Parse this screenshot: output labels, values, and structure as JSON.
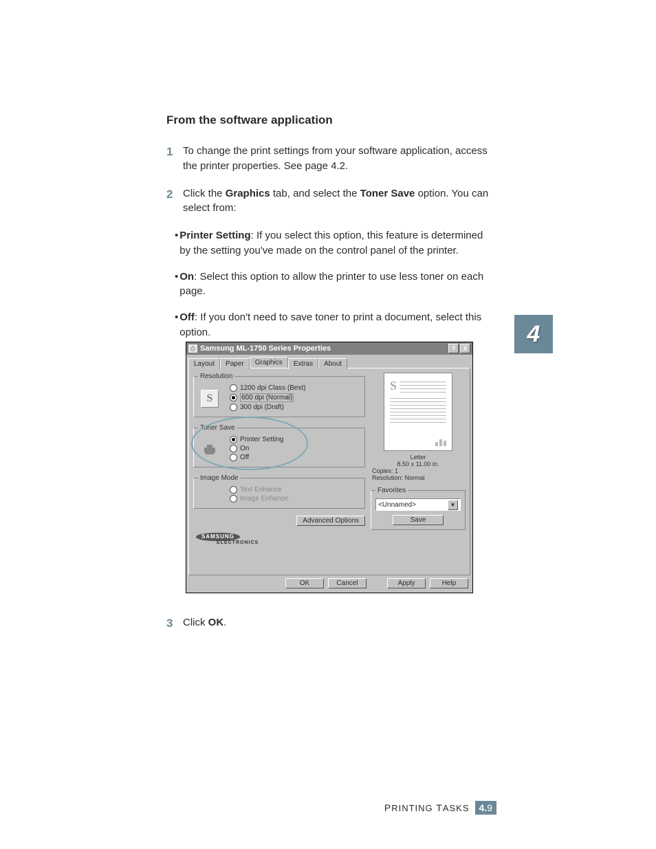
{
  "heading": "From the software application",
  "steps": {
    "s1": {
      "num": "1",
      "text_a": "To change the print settings from your software application, access the printer properties. See page 4.2."
    },
    "s2": {
      "num": "2",
      "text_a": "Click the ",
      "bold_a": "Graphics",
      "text_b": " tab, and select the ",
      "bold_b": "Toner Save",
      "text_c": " option. You can select from:"
    },
    "s3": {
      "num": "3",
      "text_a": "Click ",
      "bold_a": "OK",
      "text_b": "."
    }
  },
  "bullets": {
    "b1": {
      "bold": "Printer Setting",
      "text": ": If you select this option, this feature is determined by the setting you've made on the control panel of the printer."
    },
    "b2": {
      "bold": "On",
      "text": ": Select this option to allow the printer to use less toner on each page."
    },
    "b3": {
      "bold": "Off",
      "text": ": If you don't need to save toner to print a document, select this option."
    }
  },
  "chapter": "4",
  "footer": {
    "title": "PRINTING TASKS",
    "chapter": "4.",
    "page": "9"
  },
  "dialog": {
    "title": "Samsung ML-1750 Series Properties",
    "help": "?",
    "close": "X",
    "tabs": {
      "layout": "Layout",
      "paper": "Paper",
      "graphics": "Graphics",
      "extras": "Extras",
      "about": "About"
    },
    "resolution": {
      "legend": "Resolution",
      "r1": "1200 dpi Class (Best)",
      "r2": "600 dpi (Normal)",
      "r3": "300 dpi (Draft)"
    },
    "tonersave": {
      "legend": "Toner Save",
      "r1": "Printer Setting",
      "r2": "On",
      "r3": "Off"
    },
    "imagemode": {
      "legend": "Image Mode",
      "r1": "Text Enhance",
      "r2": "Image Enhance"
    },
    "advanced": "Advanced Options",
    "brand": "SAMSUNG",
    "brand_sub": "ELECTRONICS",
    "preview": {
      "paper": "Letter",
      "size": "8.50 x 11.00 in.",
      "copies": "Copies: 1",
      "res": "Resolution: Normal"
    },
    "favorites": {
      "legend": "Favorites",
      "value": "<Unnamed>",
      "save": "Save"
    },
    "buttons": {
      "ok": "OK",
      "cancel": "Cancel",
      "apply": "Apply",
      "help": "Help"
    }
  }
}
